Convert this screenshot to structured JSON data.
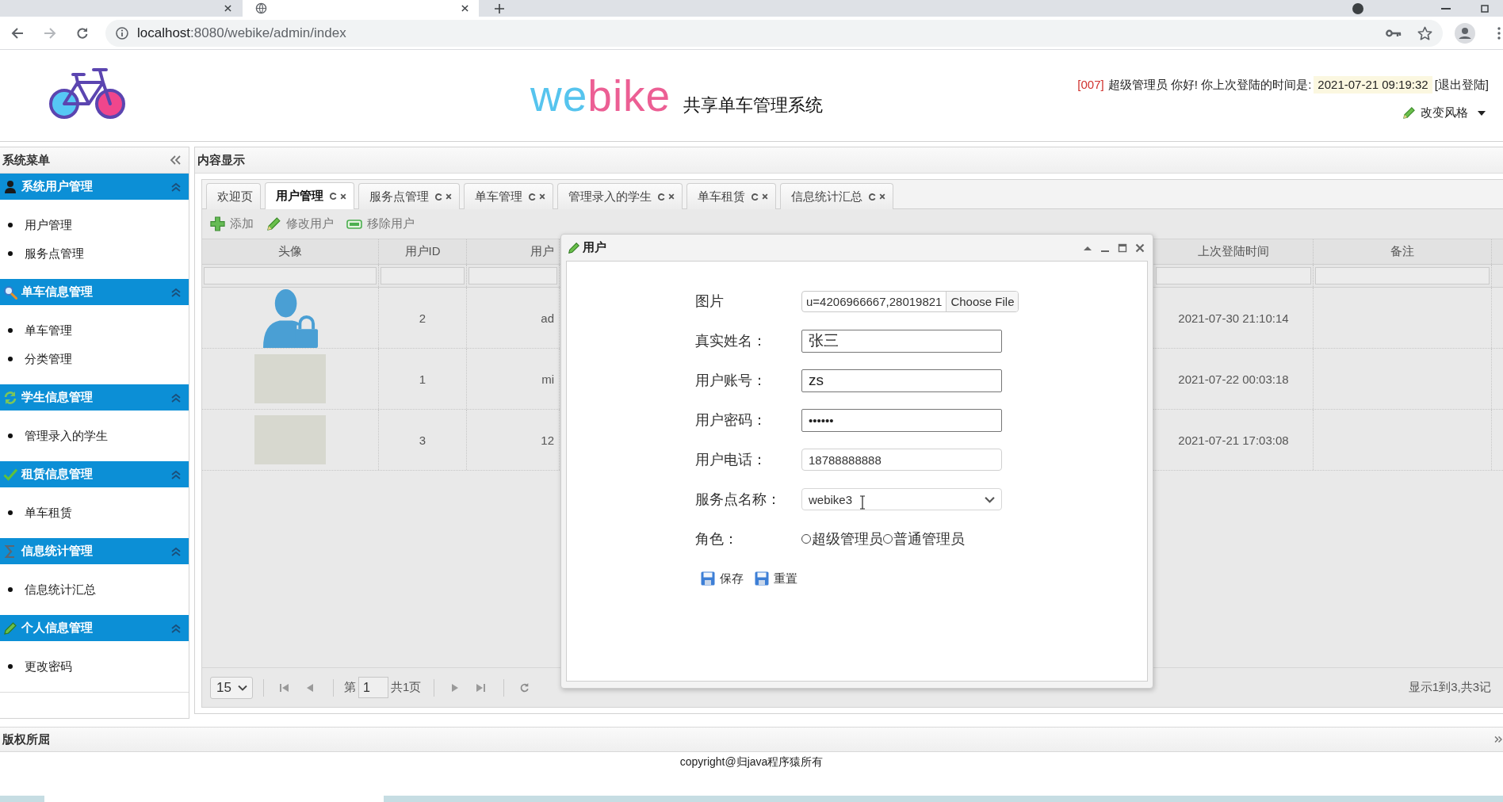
{
  "browser": {
    "tabs": [
      {
        "selected": false
      },
      {
        "selected": true
      }
    ],
    "forward_disabled": true,
    "url": {
      "host": "localhost",
      "path": ":8080/webike/admin/index"
    }
  },
  "header": {
    "brand": {
      "first": "we",
      "second": "bike"
    },
    "subtitle": "共享单车管理系统",
    "user": {
      "id": "[007]",
      "greeting": "超级管理员 你好! 你上次登陆的时间是:",
      "last_login": "2021-07-21 09:19:32",
      "logout": "[退出登陆]"
    },
    "style_menu": "改变风格"
  },
  "sidebar": {
    "title": "系统菜单",
    "sections": [
      {
        "title": "系统用户管理",
        "expanded": true,
        "items": [
          "用户管理",
          "服务点管理"
        ]
      },
      {
        "title": "单车信息管理",
        "expanded": true,
        "items": [
          "单车管理",
          "分类管理"
        ]
      },
      {
        "title": "学生信息管理",
        "expanded": true,
        "items": [
          "管理录入的学生"
        ]
      },
      {
        "title": "租赁信息管理",
        "expanded": true,
        "items": [
          "单车租赁"
        ]
      },
      {
        "title": "信息统计管理",
        "expanded": true,
        "items": [
          "信息统计汇总"
        ]
      },
      {
        "title": "个人信息管理",
        "expanded": true,
        "items": [
          "更改密码"
        ]
      }
    ]
  },
  "content": {
    "title": "内容显示",
    "tabs": [
      {
        "label": "欢迎页",
        "selected": false,
        "closable": false
      },
      {
        "label": "用户管理",
        "selected": true,
        "closable": true
      },
      {
        "label": "服务点管理",
        "selected": false,
        "closable": true
      },
      {
        "label": "单车管理",
        "selected": false,
        "closable": true
      },
      {
        "label": "管理录入的学生",
        "selected": false,
        "closable": true
      },
      {
        "label": "单车租赁",
        "selected": false,
        "closable": true
      },
      {
        "label": "信息统计汇总",
        "selected": false,
        "closable": true
      }
    ],
    "toolbar": [
      "添加",
      "修改用户",
      "移除用户"
    ],
    "grid": {
      "columns": [
        "头像",
        "用户ID",
        "用户",
        "上次登陆时间",
        "备注"
      ],
      "rows": [
        {
          "avatar": {
            "kind": "icon"
          },
          "user_id": "2",
          "column_3": "ad",
          "last_login_time": "2021-07-30 21:10:14"
        },
        {
          "avatar": {
            "kind": "photo"
          },
          "user_id": "1",
          "column_3": "mi",
          "last_login_time": "2021-07-22 00:03:18"
        },
        {
          "avatar": {
            "kind": "photo"
          },
          "user_id": "3",
          "column_3": "12",
          "last_login_time": "2021-07-21 17:03:08"
        }
      ]
    },
    "pager": {
      "page_size": "15",
      "page_label": "第",
      "page": "1",
      "total_pages": "共1页",
      "summary": "显示1到3,共3记"
    }
  },
  "dialog": {
    "title": "用户",
    "fields": [
      {
        "kind": "file",
        "label": "图片",
        "value": "u=4206966667,28019821",
        "button": "Choose File"
      },
      {
        "kind": "text",
        "label": "真实姓名：",
        "value": "张三"
      },
      {
        "kind": "text",
        "label": "用户账号：",
        "value": "zs"
      },
      {
        "kind": "password",
        "label": "用户密码：",
        "value": "••••••"
      },
      {
        "kind": "tel",
        "label": "用户电话：",
        "value": "18788888888"
      },
      {
        "kind": "select",
        "label": "服务点名称：",
        "value": "webike3"
      },
      {
        "kind": "radio",
        "label": "角色：",
        "options": [
          {
            "label": "超级管理员",
            "selected": false
          },
          {
            "label": "普通管理员",
            "selected": false
          }
        ]
      }
    ],
    "buttons": [
      "保存",
      "重置"
    ]
  },
  "footer": {
    "title": "版权所屈",
    "text": "copyright@归java程序猿所有"
  }
}
